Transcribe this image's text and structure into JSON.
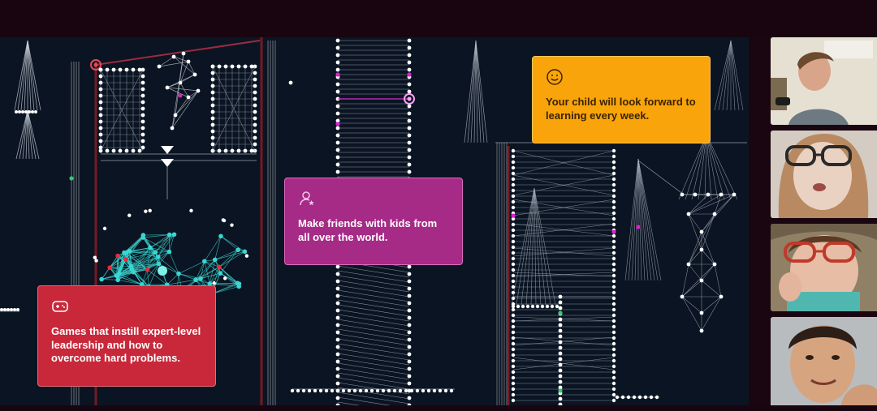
{
  "cards": [
    {
      "id": "leadership",
      "icon": "gamepad-icon",
      "text": "Games that instill expert-level leadership and how to overcome hard problems.",
      "color": "#c8283a"
    },
    {
      "id": "friends",
      "icon": "user-star-icon",
      "text": "Make friends with kids from all over the world.",
      "color": "#a62b86"
    },
    {
      "id": "learning",
      "icon": "smiley-icon",
      "text": "Your child will look forward to learning every week.",
      "color": "#f9a40a"
    }
  ],
  "participants": [
    {
      "id": "participant-1",
      "description": "boy with microphone"
    },
    {
      "id": "participant-2",
      "description": "girl with glasses"
    },
    {
      "id": "participant-3",
      "description": "girl with red glasses"
    },
    {
      "id": "participant-4",
      "description": "boy resting chin on hand"
    }
  ],
  "colors": {
    "background": "#1a0610",
    "game_background": "#0b1422",
    "node": "#ffffff",
    "network_accent": "#3ad6d0",
    "magenta_accent": "#e020d0"
  }
}
